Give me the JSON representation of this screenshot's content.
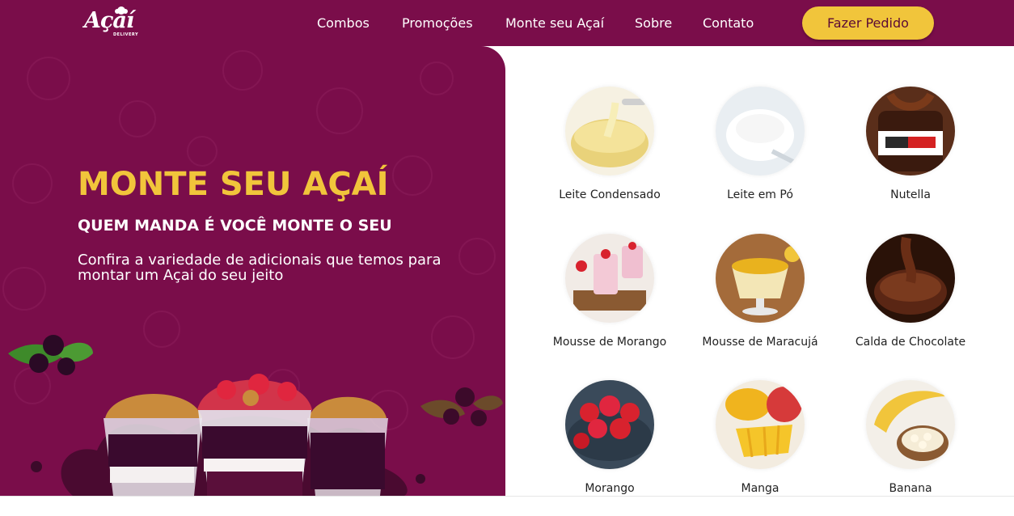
{
  "logo": {
    "word": "Açaí",
    "sub": "DELIVERY"
  },
  "nav": {
    "items": [
      {
        "label": "Combos"
      },
      {
        "label": "Promoções"
      },
      {
        "label": "Monte seu Açaí"
      },
      {
        "label": "Sobre"
      },
      {
        "label": "Contato"
      }
    ],
    "cta_label": "Fazer Pedido"
  },
  "hero": {
    "title": "MONTE SEU AÇAÍ",
    "subtitle": "QUEM MANDA É VOCÊ MONTE O SEU",
    "description": "Confira a variedade de adicionais que temos para montar um Açai do seu jeito"
  },
  "toppings": [
    {
      "label": "Leite Condensado",
      "icon": "condensed-milk"
    },
    {
      "label": "Leite em Pó",
      "icon": "powdered-milk"
    },
    {
      "label": "Nutella",
      "icon": "nutella-jar"
    },
    {
      "label": "Mousse de Morango",
      "icon": "strawberry-mousse"
    },
    {
      "label": "Mousse de Maracujá",
      "icon": "passion-fruit-mousse"
    },
    {
      "label": "Calda de Chocolate",
      "icon": "chocolate-syrup"
    },
    {
      "label": "Morango",
      "icon": "strawberries"
    },
    {
      "label": "Manga",
      "icon": "mango"
    },
    {
      "label": "Banana",
      "icon": "banana"
    }
  ],
  "colors": {
    "brand_purple": "#7a0d4a",
    "accent_yellow": "#f1c53b",
    "text_dark": "#222222"
  }
}
